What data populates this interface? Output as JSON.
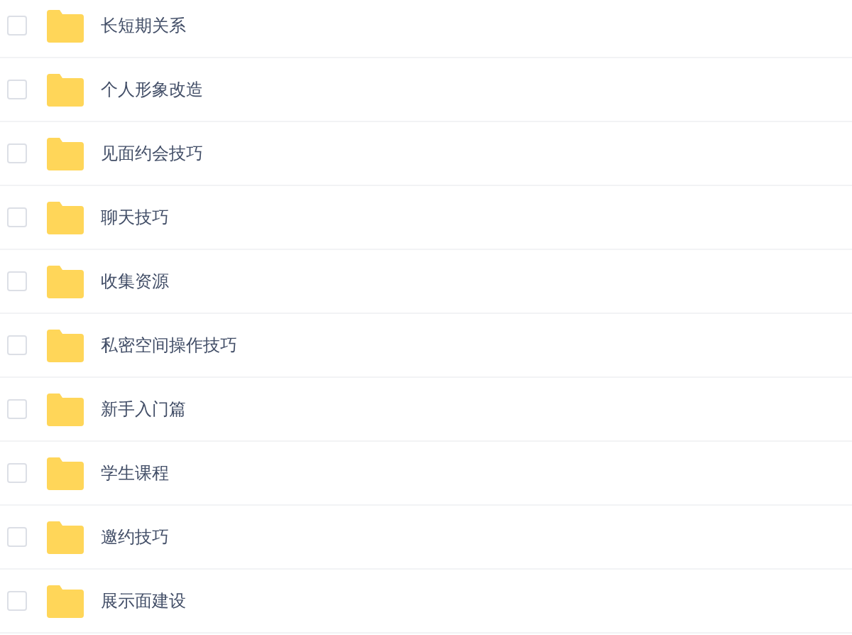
{
  "files": [
    {
      "name": "长短期关系",
      "checked": false
    },
    {
      "name": "个人形象改造",
      "checked": false
    },
    {
      "name": "见面约会技巧",
      "checked": false
    },
    {
      "name": "聊天技巧",
      "checked": false
    },
    {
      "name": "收集资源",
      "checked": false
    },
    {
      "name": "私密空间操作技巧",
      "checked": false
    },
    {
      "name": "新手入门篇",
      "checked": false
    },
    {
      "name": "学生课程",
      "checked": false
    },
    {
      "name": "邀约技巧",
      "checked": false
    },
    {
      "name": "展示面建设",
      "checked": false
    }
  ]
}
